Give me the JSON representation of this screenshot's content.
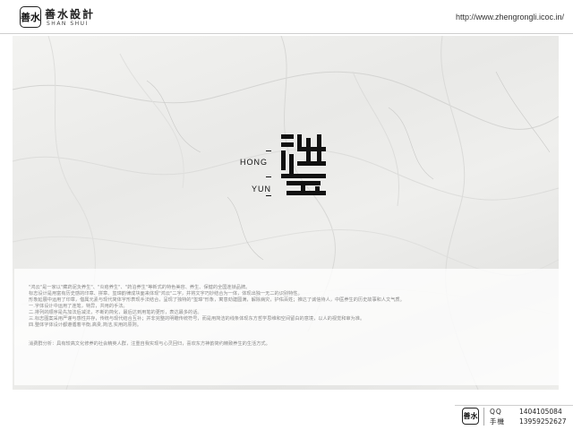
{
  "header": {
    "logo_seal": "善水",
    "logo_cn": "善水設計",
    "logo_en": "SHAN SHUI",
    "url": "http://www.zhengrongli.icoc.in/"
  },
  "brand": {
    "mark_text": "鸿运",
    "hong": "HONG",
    "yun": "YUN"
  },
  "description": {
    "lines": [
      "\"鸿云\"是一家以\"藏药泥灸养生\"、\"炎疮养生\"、\"药泊养生\"等新式的特色美容、养生、保健的全国连锁品牌。",
      "标志设计是用富有历史感的印章、拼章、玺璋韵律成块面来体现\"鸿云\"二字，并将文字巧妙结合为一体，体现出独一无二的识别特性。",
      "形象延展中运用了印章，借属元素与现代简体字形表现手法结合，呈现了独特的\"玺璋\"形象，寓意劲建圆满，解除病灾，护佑百姓；推达了诚信待人，中医养生的历史故事和人文气质。",
      "一.字体设计中运用了连笔，特异，共用的手法。",
      "二.排列的顺序是先加法后减法，不断的简化，最后达到用笔的更形，表达最多的话。",
      "三.标志图案采用严谨与感性并存，传统与现代结合互补；并非完整的明瞻传统符号，而是用简洁的线条体现东方哲学思维和空间留白的意境，以人的视觉和审为准。",
      "四.整体字体设计都遵循着平衡,高贵,简洁,实用的原则。",
      "",
      "消费群分析：具有较高文化修养的社会精英人群，注重自我实现与心灵回归，喜欢东方神韵简约精致养生的生活方式。"
    ]
  },
  "footer": {
    "seal": "善水",
    "qq_label": "QQ",
    "qq_value": "1404105084",
    "phone_label": "手機",
    "phone_value": "13959252627"
  }
}
